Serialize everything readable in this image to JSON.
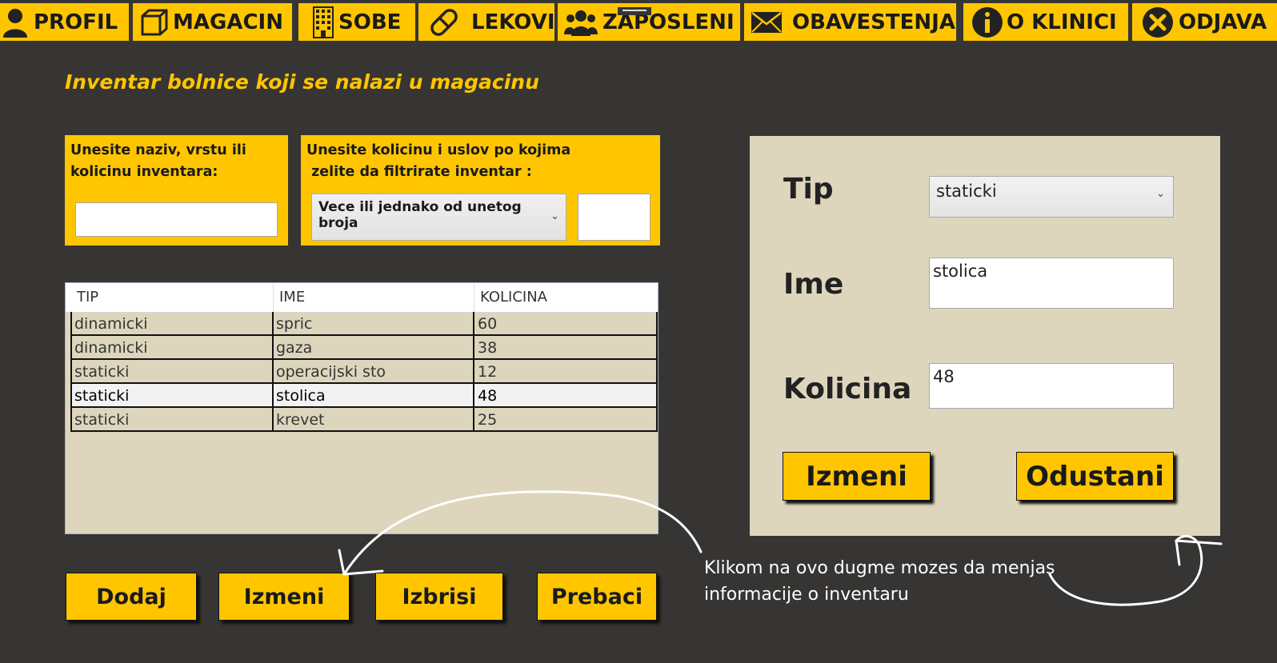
{
  "nav": {
    "items": [
      {
        "label": "PROFIL",
        "icon": "user-icon"
      },
      {
        "label": "MAGACIN",
        "icon": "box-icon"
      },
      {
        "label": "SOBE",
        "icon": "building-icon"
      },
      {
        "label": "LEKOVI",
        "icon": "pill-icon"
      },
      {
        "label": "ZAPOSLENI",
        "icon": "users-icon"
      },
      {
        "label": "OBAVESTENJA",
        "icon": "envelope-icon"
      },
      {
        "label": "O KLINICI",
        "icon": "info-icon"
      },
      {
        "label": "ODJAVA",
        "icon": "close-circle-icon"
      }
    ]
  },
  "page": {
    "title": "Inventar bolnice koji se nalazi u magacinu"
  },
  "search": {
    "label": "Unesite naziv, vrstu ili\nkolicinu inventara:",
    "value": ""
  },
  "filter": {
    "label": "Unesite kolicinu i uslov po kojima\n zelite da filtrirate inventar :",
    "condition": "Vece ili jednako od unetog broja",
    "quantity": ""
  },
  "table": {
    "columns": [
      "TIP",
      "IME",
      "KOLICINA"
    ],
    "rows": [
      [
        "dinamicki",
        "spric",
        "60"
      ],
      [
        "dinamicki",
        "gaza",
        "38"
      ],
      [
        "staticki",
        "operacijski sto",
        "12"
      ],
      [
        "staticki",
        "stolica",
        "48"
      ],
      [
        "staticki",
        "krevet",
        "25"
      ]
    ],
    "selected_index": 3
  },
  "actions": {
    "add": "Dodaj",
    "edit": "Izmeni",
    "delete": "Izbrisi",
    "move": "Prebaci"
  },
  "form": {
    "tip_label": "Tip",
    "tip_value": "staticki",
    "ime_label": "Ime",
    "ime_value": "stolica",
    "kolicina_label": "Kolicina",
    "kolicina_value": "48",
    "save": "Izmeni",
    "cancel": "Odustani"
  },
  "annotation": {
    "text": "Klikom na ovo dugme mozes da menjas\ninformacije o inventaru"
  },
  "colors": {
    "accent": "#ffc600",
    "background": "#373533",
    "panel": "#ddd6bd"
  }
}
